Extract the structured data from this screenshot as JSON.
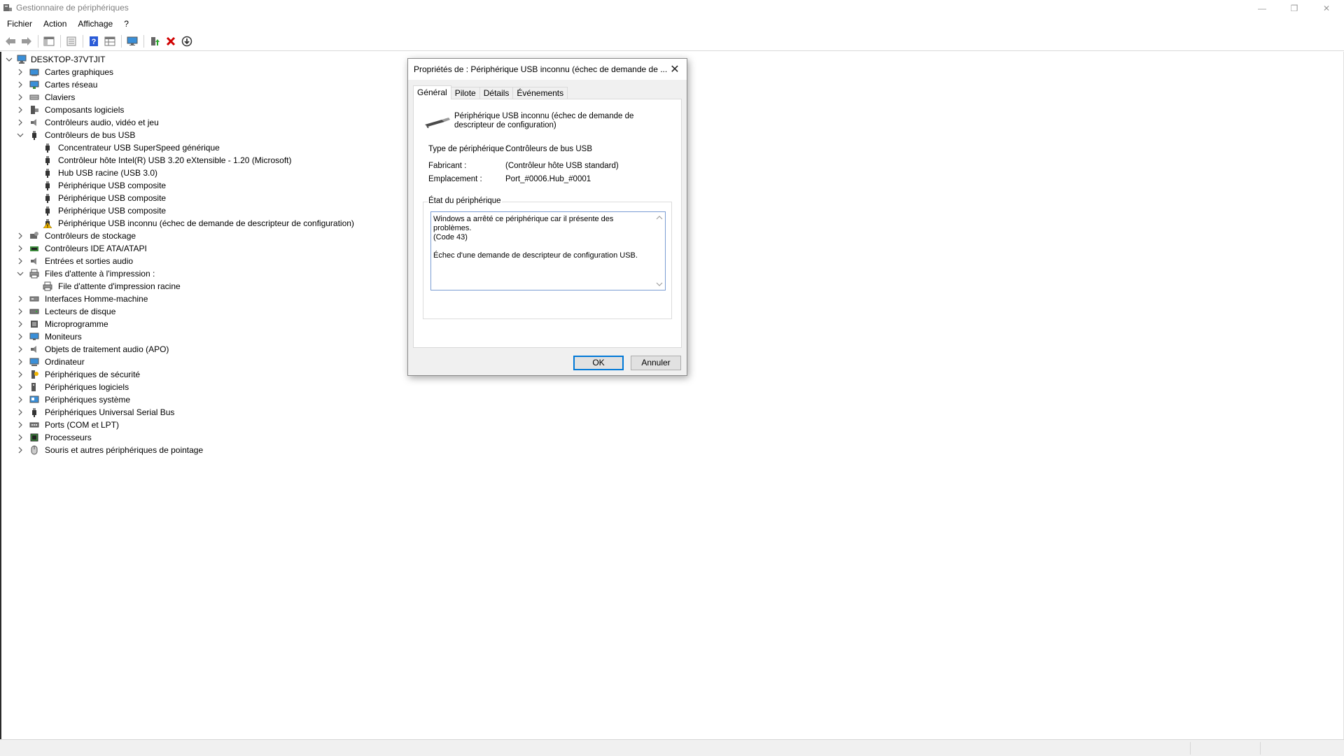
{
  "window": {
    "title": "Gestionnaire de périphériques",
    "controls": {
      "minimize": "—",
      "restore": "❐",
      "close": "✕"
    }
  },
  "menu": [
    "Fichier",
    "Action",
    "Affichage",
    "?"
  ],
  "toolbar": {
    "icons": [
      "back-icon",
      "forward-icon",
      "show-hide-tree-icon",
      "properties-icon",
      "help-icon",
      "view-icon",
      "monitor-icon",
      "update-driver-icon",
      "uninstall-icon",
      "scan-hardware-icon"
    ]
  },
  "tree": {
    "root": "DESKTOP-37VTJIT",
    "items": [
      {
        "label": "Cartes graphiques",
        "level": 1,
        "expander": "›",
        "icon": "display-adapter-icon"
      },
      {
        "label": "Cartes réseau",
        "level": 1,
        "expander": "›",
        "icon": "network-adapter-icon"
      },
      {
        "label": "Claviers",
        "level": 1,
        "expander": "›",
        "icon": "keyboard-icon"
      },
      {
        "label": "Composants logiciels",
        "level": 1,
        "expander": "›",
        "icon": "software-component-icon"
      },
      {
        "label": "Contrôleurs audio, vidéo et jeu",
        "level": 1,
        "expander": "›",
        "icon": "speaker-icon"
      },
      {
        "label": "Contrôleurs de bus USB",
        "level": 1,
        "expander": "⌄",
        "icon": "usb-icon"
      },
      {
        "label": "Concentrateur USB SuperSpeed générique",
        "level": 2,
        "expander": "",
        "icon": "usb-icon"
      },
      {
        "label": "Contrôleur hôte Intel(R) USB 3.20 eXtensible - 1.20 (Microsoft)",
        "level": 2,
        "expander": "",
        "icon": "usb-icon"
      },
      {
        "label": "Hub USB racine (USB 3.0)",
        "level": 2,
        "expander": "",
        "icon": "usb-icon"
      },
      {
        "label": "Périphérique USB composite",
        "level": 2,
        "expander": "",
        "icon": "usb-icon"
      },
      {
        "label": "Périphérique USB composite",
        "level": 2,
        "expander": "",
        "icon": "usb-icon"
      },
      {
        "label": "Périphérique USB composite",
        "level": 2,
        "expander": "",
        "icon": "usb-icon"
      },
      {
        "label": "Périphérique USB inconnu (échec de demande de descripteur de configuration)",
        "level": 2,
        "expander": "",
        "icon": "usb-warning-icon"
      },
      {
        "label": "Contrôleurs de stockage",
        "level": 1,
        "expander": "›",
        "icon": "storage-controller-icon"
      },
      {
        "label": "Contrôleurs IDE ATA/ATAPI",
        "level": 1,
        "expander": "›",
        "icon": "ide-controller-icon"
      },
      {
        "label": "Entrées et sorties audio",
        "level": 1,
        "expander": "›",
        "icon": "speaker-icon"
      },
      {
        "label": "Files d'attente à l'impression :",
        "level": 1,
        "expander": "⌄",
        "icon": "printer-icon"
      },
      {
        "label": "File d'attente d'impression racine",
        "level": 2,
        "expander": "",
        "icon": "printer-icon"
      },
      {
        "label": "Interfaces Homme-machine",
        "level": 1,
        "expander": "›",
        "icon": "hid-icon"
      },
      {
        "label": "Lecteurs de disque",
        "level": 1,
        "expander": "›",
        "icon": "disk-drive-icon"
      },
      {
        "label": "Microprogramme",
        "level": 1,
        "expander": "›",
        "icon": "firmware-icon"
      },
      {
        "label": "Moniteurs",
        "level": 1,
        "expander": "›",
        "icon": "monitor-icon"
      },
      {
        "label": "Objets de traitement audio (APO)",
        "level": 1,
        "expander": "›",
        "icon": "speaker-icon"
      },
      {
        "label": "Ordinateur",
        "level": 1,
        "expander": "›",
        "icon": "computer-icon"
      },
      {
        "label": "Périphériques de sécurité",
        "level": 1,
        "expander": "›",
        "icon": "security-device-icon"
      },
      {
        "label": "Périphériques logiciels",
        "level": 1,
        "expander": "›",
        "icon": "software-device-icon"
      },
      {
        "label": "Périphériques système",
        "level": 1,
        "expander": "›",
        "icon": "system-device-icon"
      },
      {
        "label": "Périphériques Universal Serial Bus",
        "level": 1,
        "expander": "›",
        "icon": "usb-icon"
      },
      {
        "label": "Ports (COM et LPT)",
        "level": 1,
        "expander": "›",
        "icon": "port-icon"
      },
      {
        "label": "Processeurs",
        "level": 1,
        "expander": "›",
        "icon": "processor-icon"
      },
      {
        "label": "Souris et autres périphériques de pointage",
        "level": 1,
        "expander": "›",
        "icon": "mouse-icon"
      }
    ]
  },
  "dialog": {
    "title": "Propriétés de : Périphérique USB inconnu (échec de demande de ...",
    "close": "✕",
    "tabs": [
      "Général",
      "Pilote",
      "Détails",
      "Événements"
    ],
    "active_tab": "Général",
    "device_name": "Périphérique USB inconnu (échec de demande de descripteur de configuration)",
    "type_label": "Type de périphérique :",
    "type_value": "Contrôleurs de bus USB",
    "manufacturer_label": "Fabricant :",
    "manufacturer_value": "(Contrôleur hôte USB standard)",
    "location_label": "Emplacement :",
    "location_value": "Port_#0006.Hub_#0001",
    "status_group_label": "État du périphérique",
    "status_line1": "Windows a arrêté ce périphérique car il présente des problèmes.",
    "status_line2": "(Code 43)",
    "status_line3": "Échec d'une demande de descripteur de configuration USB.",
    "ok": "OK",
    "cancel": "Annuler"
  },
  "colors": {
    "accent": "#0078d7",
    "warning": "#f2b600",
    "error": "#d00000"
  }
}
